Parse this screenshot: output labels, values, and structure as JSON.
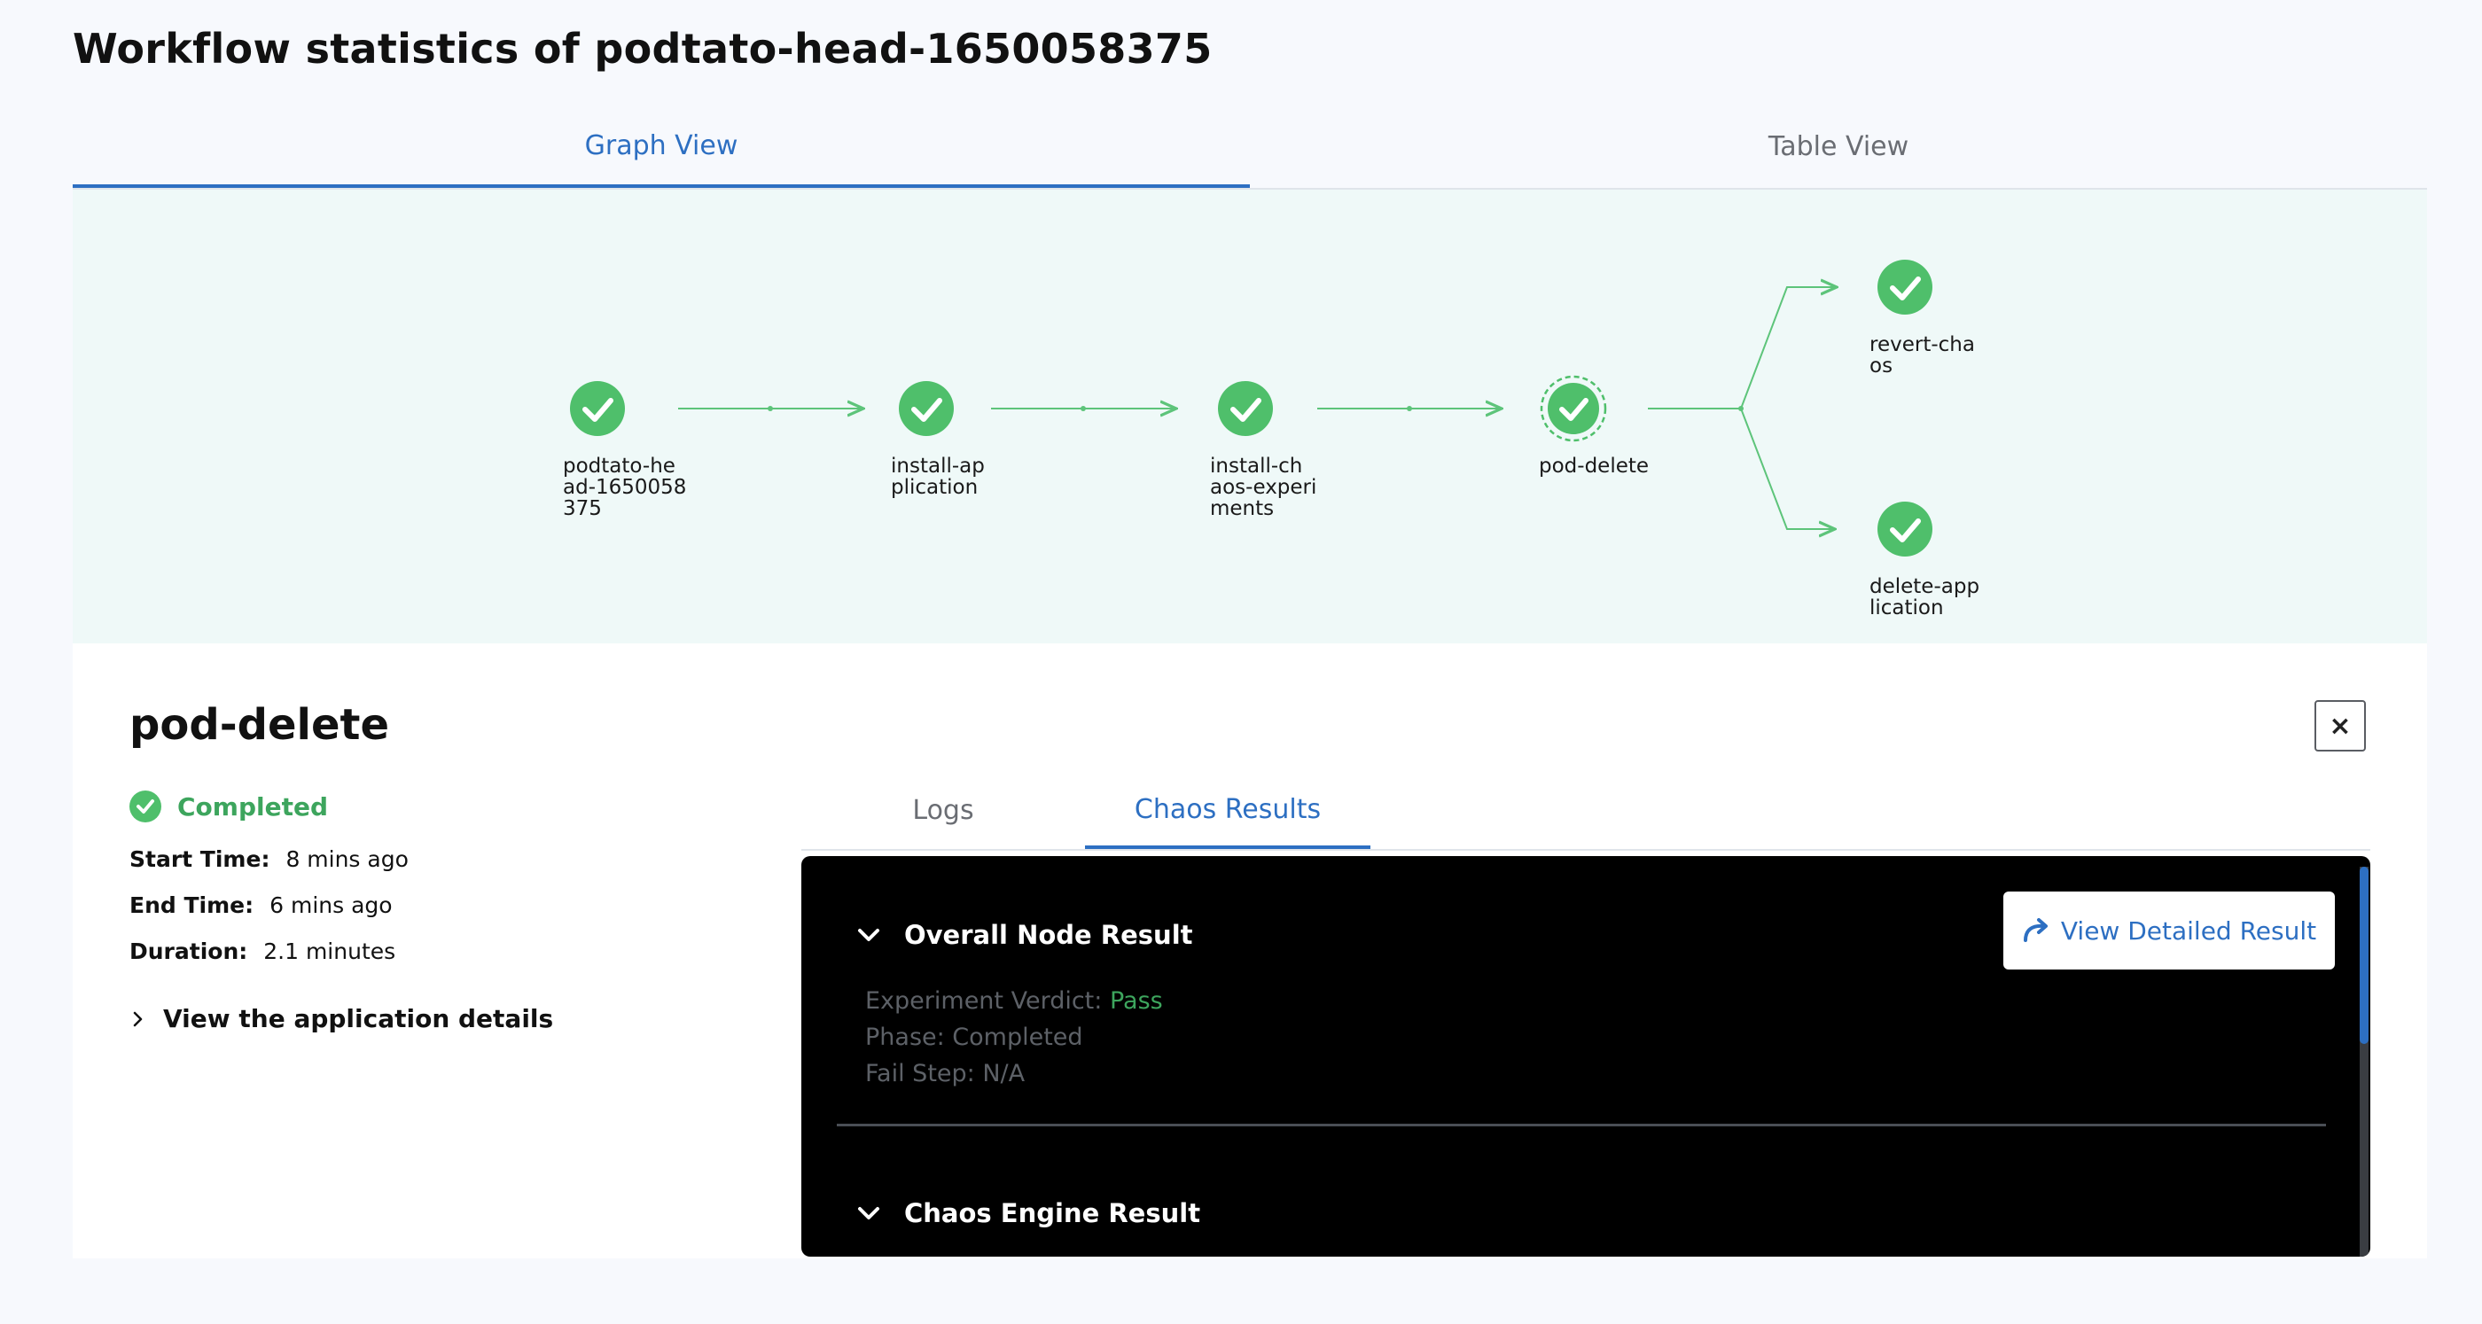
{
  "page": {
    "title": "Workflow statistics of podtato-head-1650058375"
  },
  "view_tabs": [
    {
      "label": "Graph View",
      "active": true
    },
    {
      "label": "Table View",
      "active": false
    }
  ],
  "graph": {
    "nodes": [
      {
        "label": "podtato-he\nad-1650058\n375",
        "status": "succeeded"
      },
      {
        "label": "install-ap\nplication",
        "status": "succeeded"
      },
      {
        "label": "install-ch\naos-experi\nments",
        "status": "succeeded"
      },
      {
        "label": "pod-delete",
        "status": "succeeded",
        "selected": true
      },
      {
        "label": "revert-cha\nos",
        "status": "succeeded"
      },
      {
        "label": "delete-app\nlication",
        "status": "succeeded"
      }
    ]
  },
  "node_details": {
    "title": "pod-delete",
    "status": "Completed",
    "start_time_label": "Start Time:",
    "start_time": "8 mins ago",
    "end_time_label": "End Time:",
    "end_time": "6 mins ago",
    "duration_label": "Duration:",
    "duration": "2.1 minutes",
    "app_details_label": "View the application details",
    "close_label": "×"
  },
  "detail_tabs": [
    {
      "label": "Logs",
      "active": false
    },
    {
      "label": "Chaos Results",
      "active": true
    }
  ],
  "results": {
    "overall_title": "Overall Node Result",
    "detailed_button": "View Detailed Result",
    "verdict_label": "Experiment Verdict:",
    "verdict_value": "Pass",
    "phase": "Phase: Completed",
    "fail_step": "Fail Step: N/A",
    "engine_title": "Chaos Engine Result"
  },
  "colors": {
    "accent": "#2d6fc2",
    "success": "#3da55d",
    "graph_bg": "#eff9f8",
    "edge": "#5dc47a"
  }
}
